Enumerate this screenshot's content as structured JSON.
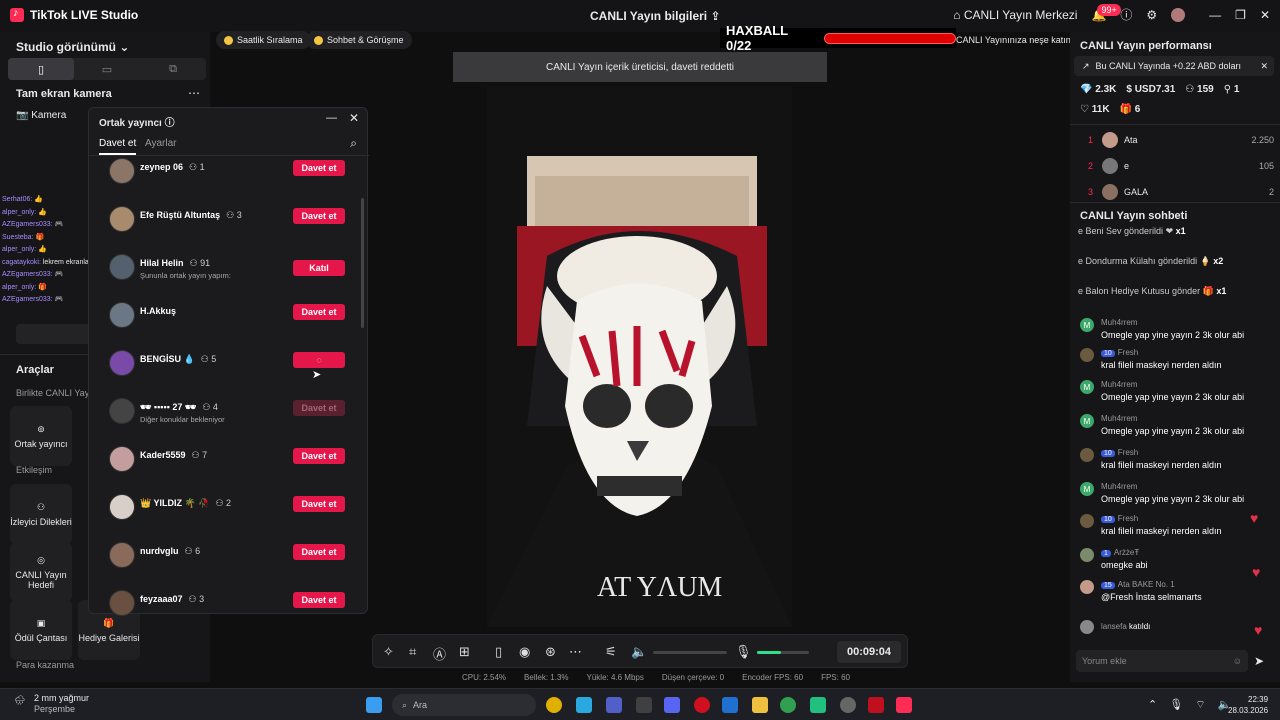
{
  "app": {
    "title": "TikTok LIVE Studio",
    "center_title": "CANLI Yayın bilgileri",
    "live_center": "CANLI Yayın Merkezi",
    "notif_count": "99+"
  },
  "left": {
    "studio_view": "Studio görünümü",
    "fullscreen_camera": "Tam ekran kamera",
    "camera": "Kamera",
    "tools": "Araçlar",
    "together_live": "Birlikte CANLI Yayı",
    "co_host": "Ortak yayıncı",
    "interaction": "Etkileşim",
    "viewer_requests": "İzleyici Dilekleri",
    "live_goal": "CANLI Yayın Hedefi",
    "reward_bag": "Ödül Çantası",
    "gift_gallery": "Hediye Galerisi",
    "earn_money": "Para kazanma"
  },
  "overlay_chat": [
    {
      "name": "Serhat06:",
      "text": "👍"
    },
    {
      "name": "alper_only:",
      "text": "👍"
    },
    {
      "name": "AZEgamers033:",
      "text": "🎮"
    },
    {
      "name": "Suesteba:",
      "text": "🎁"
    },
    {
      "name": "alper_only:",
      "text": "👍"
    },
    {
      "name": "cagataykoki:",
      "text": "lekrem ekranlar gözlük yapsalım oruu"
    },
    {
      "name": "AZEgamers033:",
      "text": "🎮"
    },
    {
      "name": "alper_only:",
      "text": "🎁"
    },
    {
      "name": "AZEgamers033:",
      "text": "🎮"
    }
  ],
  "chips": [
    "Saatlik Sıralama",
    "Sohbet & Görüşme"
  ],
  "haxball": {
    "label": "HAXBALL 0/22",
    "caption": "CANLI Yayınınıza neşe katın"
  },
  "toast": "CANLI Yayın içerik üreticisi, daveti reddetti",
  "popup": {
    "title": "Ortak yayıncı",
    "tab_invite": "Davet et",
    "tab_settings": "Ayarlar",
    "rows": [
      {
        "name": "zeynep 06",
        "count": "1",
        "sub": "",
        "button": "Davet et",
        "state": "active"
      },
      {
        "name": "Efe Rüştü Altuntaş",
        "count": "3",
        "sub": "",
        "button": "Davet et",
        "state": "active"
      },
      {
        "name": "Hilal Helin",
        "count": "91",
        "sub": "Şununla ortak yayın yapım:",
        "button": "Katıl",
        "state": "active"
      },
      {
        "name": "H.Akkuş",
        "count": "",
        "sub": "",
        "button": "Davet et",
        "state": "active"
      },
      {
        "name": "BENGİSU 💧",
        "count": "5",
        "sub": "",
        "button": "◌",
        "state": "loading"
      },
      {
        "name": "🕶 ▪▪▪▪▪ 27 🕶",
        "count": "4",
        "sub": "Diğer konuklar bekleniyor",
        "button": "Davet et",
        "state": "disabled"
      },
      {
        "name": "Kader5559",
        "count": "7",
        "sub": "",
        "button": "Davet et",
        "state": "active"
      },
      {
        "name": "👑 YILDIZ 🌴 🥀",
        "count": "2",
        "sub": "",
        "button": "Davet et",
        "state": "active"
      },
      {
        "name": "nurdvglu",
        "count": "6",
        "sub": "",
        "button": "Davet et",
        "state": "active"
      },
      {
        "name": "feyzaaa07",
        "count": "3",
        "sub": "",
        "button": "Davet et",
        "state": "active"
      }
    ]
  },
  "toolbar": {
    "timer": "00:09:04"
  },
  "stats": [
    "CPU: 2.54%",
    "Bellek: 1.3%",
    "Yükle: 4.6 Mbps",
    "Düşen çerçeve: 0",
    "Encoder FPS: 60",
    "FPS: 60"
  ],
  "right": {
    "perf_title": "CANLI Yayın performansı",
    "perf_banner": "Bu CANLI Yayında +0.22 ABD doları",
    "coins": "2.3K",
    "usd": "USD7.31",
    "viewers": "159",
    "new_followers": "1",
    "likes": "11K",
    "gifts": "6",
    "ranking": [
      {
        "rank": "1",
        "name": "Ata",
        "score": "2.250"
      },
      {
        "rank": "2",
        "name": "e",
        "score": "105"
      },
      {
        "rank": "3",
        "name": "GALA",
        "score": "2"
      }
    ],
    "chat_title": "CANLI Yayın sohbeti",
    "gifts_list": [
      {
        "text": "e Beni Sev gönderildi",
        "mult": "x1"
      },
      {
        "text": "e Dondurma Külahı gönderildi",
        "mult": "x2"
      },
      {
        "text": "e Balon Hediye Kutusu gönder",
        "mult": "x1"
      }
    ],
    "chat": [
      {
        "name": "Muh4rrem",
        "text": "Omegle yap yine yayın 2 3k olur abi",
        "lvl": ""
      },
      {
        "name": "Fresh",
        "text": "kral fileli maskeyi nerden aldın",
        "lvl": "10"
      },
      {
        "name": "Muh4rrem",
        "text": "Omegle yap yine yayın 2 3k olur abi",
        "lvl": ""
      },
      {
        "name": "Muh4rrem",
        "text": "Omegle yap yine yayın 2 3k olur abi",
        "lvl": ""
      },
      {
        "name": "Fresh",
        "text": "kral fileli maskeyi nerden aldın",
        "lvl": "10"
      },
      {
        "name": "Muh4rrem",
        "text": "Omegle yap yine yayın 2 3k olur abi",
        "lvl": ""
      },
      {
        "name": "Fresh",
        "text": "kral fileli maskeyi nerden aldın",
        "lvl": "10"
      },
      {
        "name": "ArżżeŦ",
        "text": "omegke abi",
        "lvl": "1"
      },
      {
        "name": "Ata  BAKE  No. 1",
        "text": "@Fresh İnsta selmanarts",
        "lvl": "15"
      },
      {
        "name": "lansefa",
        "text": "katıldı",
        "lvl": ""
      }
    ],
    "comment_placeholder": "Yorum ekle"
  },
  "taskbar": {
    "weather_temp": "2 mm yağmur",
    "weather_day": "Perşembe",
    "search": "Ara",
    "time": "22:39",
    "date": "28.03.2026"
  }
}
